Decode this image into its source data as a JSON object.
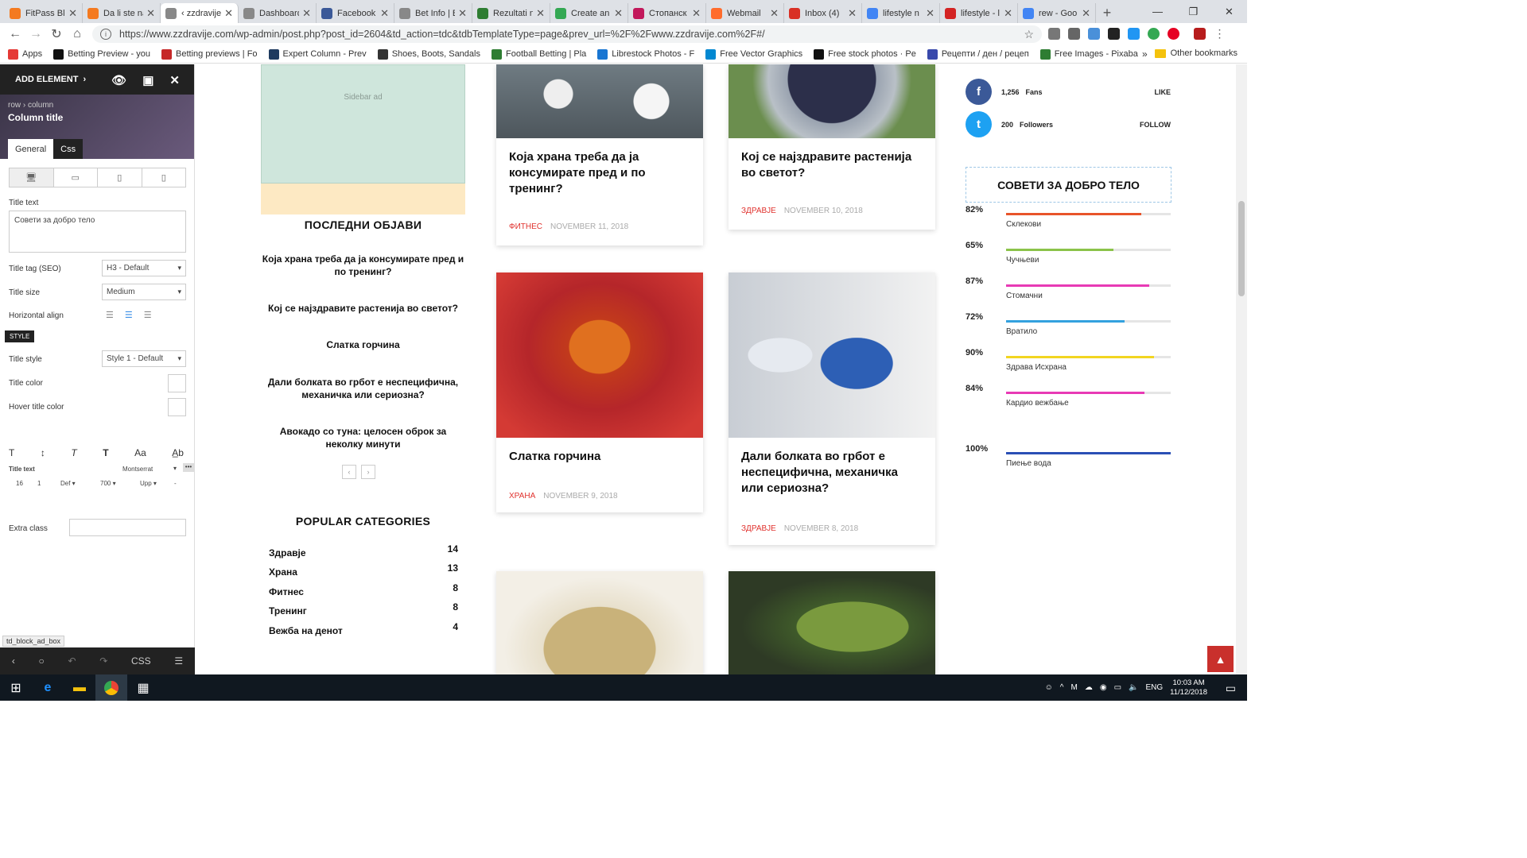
{
  "browser": {
    "tabs": [
      {
        "title": "FitPass Blo",
        "icon": "orange-runner-icon",
        "color": "#f47a20"
      },
      {
        "title": "Da li ste na",
        "icon": "orange-runner-icon",
        "color": "#f47a20"
      },
      {
        "title": "‹ zzdravije",
        "icon": "page-icon",
        "color": "#888888"
      },
      {
        "title": "Dashboard",
        "icon": "page-icon",
        "color": "#888888"
      },
      {
        "title": "Facebook",
        "icon": "facebook-icon",
        "color": "#3b5998"
      },
      {
        "title": "Bet Info | B",
        "icon": "page-icon",
        "color": "#888888"
      },
      {
        "title": "Rezultati n",
        "icon": "rezultati-icon",
        "color": "#2e7d32"
      },
      {
        "title": "Create an",
        "icon": "green-g-icon",
        "color": "#34a853"
      },
      {
        "title": "Стопанск",
        "icon": "pink-icon",
        "color": "#c2185b"
      },
      {
        "title": "Webmail",
        "icon": "cpanel-icon",
        "color": "#ff6c2c"
      },
      {
        "title": "Inbox (4)",
        "icon": "gmail-icon",
        "color": "#d93025"
      },
      {
        "title": "lifestyle n",
        "icon": "google-icon",
        "color": "#4285f4"
      },
      {
        "title": "lifestyle - l",
        "icon": "yelp-icon",
        "color": "#d32323"
      },
      {
        "title": "rew - Goo",
        "icon": "google-icon",
        "color": "#4285f4"
      }
    ],
    "url": "https://www.zzdravije.com/wp-admin/post.php?post_id=2604&td_action=tdc&tdbTemplateType=page&prev_url=%2F%2Fwww.zzdravije.com%2F#/",
    "bookmarks": [
      {
        "label": "Apps",
        "color": "#e53935"
      },
      {
        "label": "Betting Preview - you",
        "color": "#111111"
      },
      {
        "label": "Betting previews | Fo",
        "color": "#c62828"
      },
      {
        "label": "Expert Column - Prev",
        "color": "#1e3a5f"
      },
      {
        "label": "Shoes, Boots, Sandals",
        "color": "#333333"
      },
      {
        "label": "Football Betting | Pla",
        "color": "#2e7d32"
      },
      {
        "label": "Librestock Photos - F",
        "color": "#1976d2"
      },
      {
        "label": "Free Vector Graphics",
        "color": "#0288d1"
      },
      {
        "label": "Free stock photos · Pe",
        "color": "#111111"
      },
      {
        "label": "Рецепти / ден / рецеп",
        "color": "#3949ab"
      },
      {
        "label": "Free Images - Pixaba",
        "color": "#2e7d32"
      }
    ],
    "bookmarks_more": "»",
    "other_bookmarks": "Other bookmarks"
  },
  "editor": {
    "add_element": "ADD ELEMENT",
    "breadcrumb": "row › column",
    "column_title": "Column title",
    "tab_general": "General",
    "tab_css": "Css",
    "title_text_label": "Title text",
    "title_text_value": "Совети за добро тело",
    "title_tag_label": "Title tag (SEO)",
    "title_tag_value": "H3 - Default",
    "title_size_label": "Title size",
    "title_size_value": "Medium",
    "h_align_label": "Horizontal align",
    "style_badge": "STYLE",
    "title_style_label": "Title style",
    "title_style_value": "Style 1 - Default",
    "title_color_label": "Title color",
    "hover_color_label": "Hover title color",
    "typo_label": "Title text",
    "typo_font": "Montserrat",
    "typo_size": "16",
    "typo_lh": "1",
    "typo_style": "Def",
    "typo_weight": "700",
    "typo_transform": "Upp",
    "typo_spacing": "-",
    "extra_class_label": "Extra class",
    "block_label": "td_block_ad_box",
    "css_btn": "CSS"
  },
  "site": {
    "ad_label": "Sidebar ad",
    "recent_title": "ПОСЛЕДНИ ОБЈАВИ",
    "recent_posts": [
      "Која храна треба да ја консумирате пред и по тренинг?",
      "Кој се најздравите растенија во светот?",
      "Слатка горчина",
      "Дали болката во грбот е неспецифична, механичка или сериозна?",
      "Авокадо со туна: целосен оброк за неколку минути"
    ],
    "pager_prev": "‹",
    "pager_next": "›",
    "categories_title": "POPULAR CATEGORIES",
    "categories": [
      {
        "name": "Здравје",
        "count": "14"
      },
      {
        "name": "Храна",
        "count": "13"
      },
      {
        "name": "Фитнес",
        "count": "8"
      },
      {
        "name": "Тренинг",
        "count": "8"
      },
      {
        "name": "Вежба на денот",
        "count": "4"
      }
    ],
    "posts": [
      {
        "title": "Која храна треба да ја консумирате пред и по тренинг?",
        "category": "ФИТНЕС",
        "date": "NOVEMBER 11, 2018"
      },
      {
        "title": "Кој се најздравите растенија во светот?",
        "category": "ЗДРАВЈЕ",
        "date": "NOVEMBER 10, 2018"
      },
      {
        "title": "Слатка горчина",
        "category": "ХРАНА",
        "date": "NOVEMBER 9, 2018"
      },
      {
        "title": "Дали болката во грбот е неспецифична, механичка или сериозна?",
        "category": "ЗДРАВЈЕ",
        "date": "NOVEMBER 8, 2018"
      }
    ],
    "social": [
      {
        "count": "1,256",
        "label": "Fans",
        "action": "LIKE",
        "color": "#3b5998",
        "icon": "facebook-icon",
        "glyph": "f"
      },
      {
        "count": "200",
        "label": "Followers",
        "action": "FOLLOW",
        "color": "#1da1f2",
        "icon": "twitter-icon",
        "glyph": "t"
      }
    ],
    "tips_title": "СОВЕТИ ЗА ДОБРО ТЕЛО",
    "tips": [
      {
        "pct": "82%",
        "value": 0.82,
        "label": "Склекови",
        "color": "#e8542a"
      },
      {
        "pct": "65%",
        "value": 0.65,
        "label": "Чучњеви",
        "color": "#8bc34a"
      },
      {
        "pct": "87%",
        "value": 0.87,
        "label": "Стомачни",
        "color": "#e83ab5"
      },
      {
        "pct": "72%",
        "value": 0.72,
        "label": "Вратило",
        "color": "#33a1de"
      },
      {
        "pct": "90%",
        "value": 0.9,
        "label": "Здрава Исхрана",
        "color": "#f2d520"
      },
      {
        "pct": "84%",
        "value": 0.84,
        "label": "Кардио вежбање",
        "color": "#e83ab5"
      },
      {
        "pct": "100%",
        "value": 1.0,
        "label": "Пиење вода",
        "color": "#2a4fb5"
      }
    ]
  },
  "taskbar": {
    "lang": "ENG",
    "time": "10:03 AM",
    "date": "11/12/2018"
  }
}
